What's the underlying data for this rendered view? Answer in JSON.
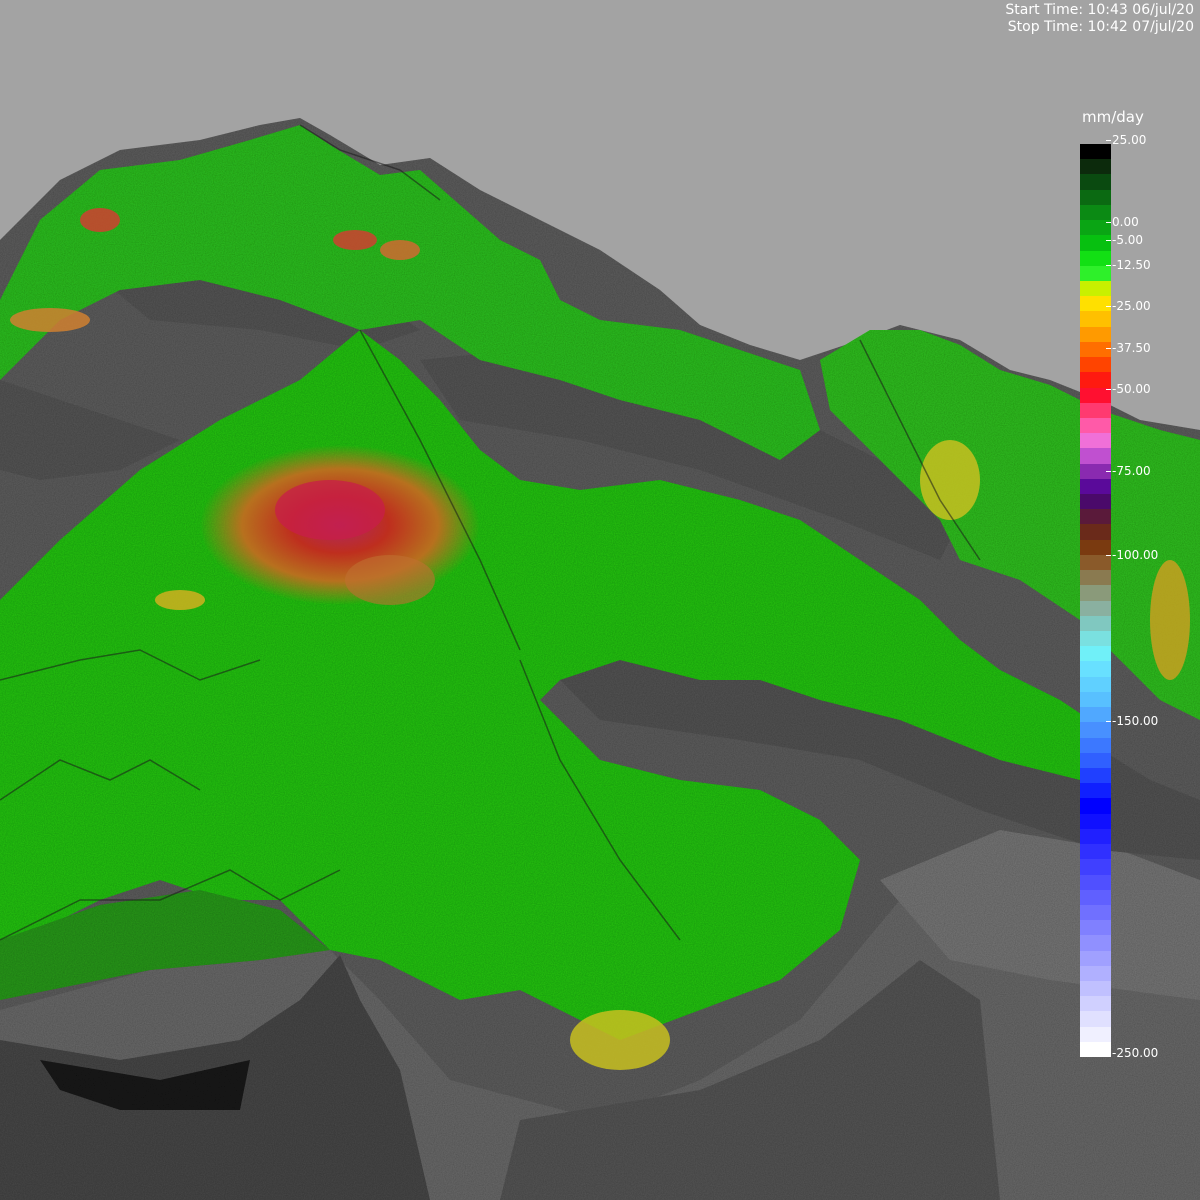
{
  "time": {
    "start": "Start Time: 10:43 06/jul/20",
    "stop": "Stop Time: 10:42 07/jul/20"
  },
  "legend": {
    "unit": "mm/day",
    "min": -250,
    "max": 25,
    "ticks": [
      {
        "value": 25,
        "label": "25.00"
      },
      {
        "value": 0,
        "label": "0.00"
      },
      {
        "value": -5,
        "label": "-5.00"
      },
      {
        "value": -12.5,
        "label": "-12.50"
      },
      {
        "value": -25,
        "label": "-25.00"
      },
      {
        "value": -37.5,
        "label": "-37.50"
      },
      {
        "value": -50,
        "label": "-50.00"
      },
      {
        "value": -75,
        "label": "-75.00"
      },
      {
        "value": -100,
        "label": "-100.00"
      },
      {
        "value": -150,
        "label": "-150.00"
      },
      {
        "value": -250,
        "label": "-250.00"
      }
    ],
    "colors": [
      "#000000",
      "#0c2a0c",
      "#0a4a10",
      "#0b6a12",
      "#0b8a14",
      "#0aa514",
      "#07c010",
      "#12e014",
      "#2ef02a",
      "#c8f000",
      "#ffe000",
      "#ffc000",
      "#ff9a00",
      "#ff6e00",
      "#ff4400",
      "#ff1a10",
      "#ff1030",
      "#ff3a70",
      "#ff5aa8",
      "#f070d8",
      "#c050d0",
      "#8a2ab0",
      "#5a0a9a",
      "#4a0a6a",
      "#5a1a3a",
      "#6a2a1a",
      "#7a3a10",
      "#8a5a2a",
      "#8a7a50",
      "#8a9a7a",
      "#8ab0a0",
      "#80c8c0",
      "#7ae0e0",
      "#70f0f8",
      "#68e0ff",
      "#60d0ff",
      "#58c0ff",
      "#50a8ff",
      "#4890ff",
      "#3c78ff",
      "#3060ff",
      "#2040ff",
      "#1020ff",
      "#0000ff",
      "#1010ff",
      "#2020ff",
      "#3030ff",
      "#4040ff",
      "#5050ff",
      "#6060ff",
      "#7070ff",
      "#8080ff",
      "#9090ff",
      "#a0a0ff",
      "#b0b0ff",
      "#c0c0ff",
      "#d0d0ff",
      "#e0e0ff",
      "#f0f0ff",
      "#ffffff"
    ]
  }
}
